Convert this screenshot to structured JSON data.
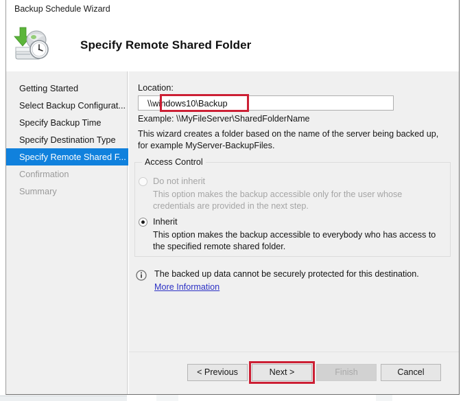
{
  "window": {
    "title": "Backup Schedule Wizard"
  },
  "header": {
    "icon": "backup-schedule-icon",
    "title": "Specify Remote Shared Folder"
  },
  "sidebar": {
    "items": [
      {
        "label": "Getting Started",
        "state": "normal"
      },
      {
        "label": "Select Backup Configurat...",
        "state": "normal"
      },
      {
        "label": "Specify Backup Time",
        "state": "normal"
      },
      {
        "label": "Specify Destination Type",
        "state": "normal"
      },
      {
        "label": "Specify Remote Shared F...",
        "state": "selected"
      },
      {
        "label": "Confirmation",
        "state": "disabled"
      },
      {
        "label": "Summary",
        "state": "disabled"
      }
    ],
    "selected_color": "#1081dd"
  },
  "main": {
    "location_label": "Location:",
    "location_value": "\\\\windows10\\Backup",
    "location_placeholder": "",
    "example_line": "Example: \\\\MyFileServer\\SharedFolderName",
    "description": "This wizard creates a folder based on the name of the server being backed up, for example MyServer-BackupFiles.",
    "access_control": {
      "legend": "Access Control",
      "options": [
        {
          "label": "Do not inherit",
          "description": "This option makes the backup accessible only for the user whose credentials are provided in the next step.",
          "selected": false,
          "enabled": false
        },
        {
          "label": "Inherit",
          "description": "This option makes the backup accessible to everybody who has access to the specified remote shared folder.",
          "selected": true,
          "enabled": true
        }
      ]
    },
    "notice": {
      "icon": "information-icon",
      "text": "The backed up data cannot be securely protected for this destination.",
      "link_label": "More Information",
      "link_color": "#2b30c4"
    }
  },
  "footer": {
    "buttons": [
      {
        "label": "< Previous",
        "enabled": true,
        "highlighted": false
      },
      {
        "label": "Next >",
        "enabled": true,
        "highlighted": true
      },
      {
        "label": "Finish",
        "enabled": false,
        "highlighted": false
      },
      {
        "label": "Cancel",
        "enabled": true,
        "highlighted": false
      }
    ]
  },
  "annotations": {
    "highlight_color": "#cc1f34",
    "targets": [
      "location-input",
      "next-button"
    ]
  }
}
